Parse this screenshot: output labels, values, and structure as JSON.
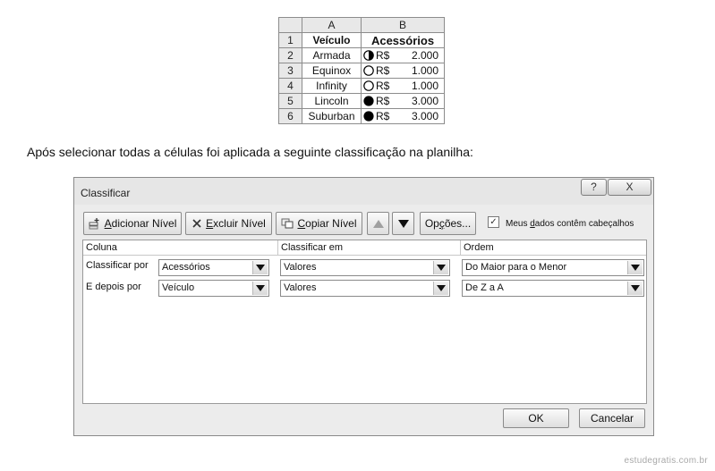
{
  "sheet": {
    "col_headers": [
      "A",
      "B"
    ],
    "header_row": {
      "num": "1",
      "a": "Veículo",
      "b": "Acessórios"
    },
    "rows": [
      {
        "num": "2",
        "vehicle": "Armada",
        "icon": "half-circle",
        "currency": "R$",
        "value": "2.000"
      },
      {
        "num": "3",
        "vehicle": "Equinox",
        "icon": "empty-circle",
        "currency": "R$",
        "value": "1.000"
      },
      {
        "num": "4",
        "vehicle": "Infinity",
        "icon": "empty-circle",
        "currency": "R$",
        "value": "1.000"
      },
      {
        "num": "5",
        "vehicle": "Lincoln",
        "icon": "full-circle",
        "currency": "R$",
        "value": "3.000"
      },
      {
        "num": "6",
        "vehicle": "Suburban",
        "icon": "full-circle",
        "currency": "R$",
        "value": "3.000"
      }
    ]
  },
  "caption": "Após selecionar todas a células foi aplicada a seguinte classificação na planilha:",
  "dialog": {
    "title": "Classificar",
    "help_label": "?",
    "close_label": "X",
    "toolbar": {
      "add_pre": "",
      "add_ul": "A",
      "add_post": "dicionar Nível",
      "delete_pre": "",
      "delete_ul": "E",
      "delete_post": "xcluir Nível",
      "copy_pre": "",
      "copy_ul": "C",
      "copy_post": "opiar Nível",
      "options_pre": "Op",
      "options_ul": "ç",
      "options_post": "ões...",
      "checkbox_pre": "Meus ",
      "checkbox_ul": "d",
      "checkbox_post": "ados contêm cabeçalhos",
      "checkbox_checked": true
    },
    "columns": {
      "column": "Coluna",
      "sort_on": "Classificar em",
      "order": "Ordem"
    },
    "levels": [
      {
        "label": "Classificar por",
        "column": "Acessórios",
        "sort_on": "Valores",
        "order": "Do Maior para o Menor"
      },
      {
        "label": "E depois por",
        "column": "Veículo",
        "sort_on": "Valores",
        "order": "De Z a A"
      }
    ],
    "ok_label": "OK",
    "cancel_label": "Cancelar"
  },
  "watermark": "estudegratis.com.br",
  "icons": [
    "half-circle-icon",
    "empty-circle-icon",
    "full-circle-icon",
    "chevron-down-icon",
    "arrow-up-icon",
    "arrow-down-icon",
    "add-level-icon",
    "delete-level-icon",
    "copy-level-icon"
  ]
}
